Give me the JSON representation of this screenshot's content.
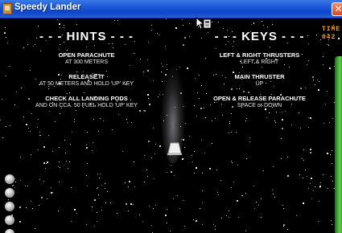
{
  "window": {
    "title": "Speedy Lander",
    "close_glyph": "✕"
  },
  "hints": {
    "heading": "- - - HINTS - - -",
    "items": [
      {
        "title": "OPEN PARACHUTE",
        "sub": "AT 300 METERS"
      },
      {
        "title": "RELEASE IT",
        "sub": "AT 50 METERS AND HOLD 'UP' KEY"
      },
      {
        "title": "CHECK ALL LANDING PODS",
        "sub": "AND ON CCA. 50 FUEL HOLD 'UP' KEY"
      }
    ]
  },
  "keys": {
    "heading": "- - - KEYS - - -",
    "items": [
      {
        "title": "LEFT & RIGHT THRUSTERS",
        "sub": "LEFT & RIGHT"
      },
      {
        "title": "MAIN THRUSTER",
        "sub": "UP"
      },
      {
        "title": "OPEN & RELEASE PARACHUTE",
        "sub": "SPACE or DOWN"
      }
    ]
  },
  "hud": {
    "time_label": "TIME",
    "time_value": "042"
  },
  "icons": [
    "app-icon",
    "close-icon",
    "mouse-cursor-icon",
    "lander-icon",
    "landing-pod-icon"
  ],
  "colors": {
    "titlebar": "#1a56d8",
    "hud_text": "#ffa020",
    "fuel_bar": "#4caf3a",
    "background": "#000000"
  }
}
